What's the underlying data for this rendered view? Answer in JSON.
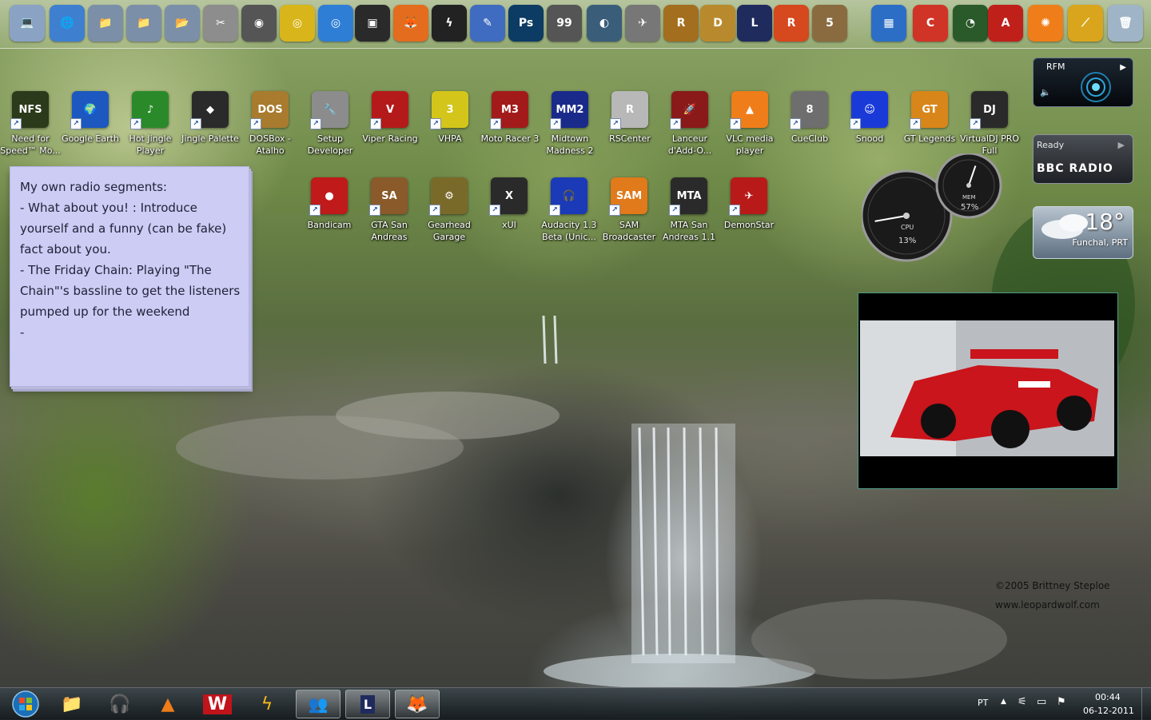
{
  "dock": {
    "items": [
      {
        "name": "computer",
        "glyph": "💻",
        "color": "#8aa3c4"
      },
      {
        "name": "network",
        "glyph": "🌐",
        "color": "#3f7fd0"
      },
      {
        "name": "folder-1",
        "glyph": "📁",
        "color": "#7c8fa8"
      },
      {
        "name": "folder-2",
        "glyph": "📁",
        "color": "#7c8fa8"
      },
      {
        "name": "folder-3",
        "glyph": "📂",
        "color": "#7c8fa8"
      },
      {
        "name": "tools",
        "glyph": "✂",
        "color": "#8d8d8d"
      },
      {
        "name": "speaker",
        "glyph": "◉",
        "color": "#555"
      },
      {
        "name": "cd",
        "glyph": "◎",
        "color": "#d8b51a"
      },
      {
        "name": "dvd",
        "glyph": "◎",
        "color": "#2e7ed6"
      },
      {
        "name": "webcam",
        "glyph": "▣",
        "color": "#2a2a2a"
      },
      {
        "name": "firefox",
        "glyph": "🦊",
        "color": "#e46c1e"
      },
      {
        "name": "winamp",
        "glyph": "ϟ",
        "color": "#222"
      },
      {
        "name": "paint",
        "glyph": "✎",
        "color": "#3f6cc0"
      },
      {
        "name": "photoshop",
        "glyph": "Ps",
        "color": "#0c3b63"
      },
      {
        "name": "monitor-99",
        "glyph": "99",
        "color": "#555"
      },
      {
        "name": "teamspeak",
        "glyph": "◐",
        "color": "#3a5d7a"
      },
      {
        "name": "plane",
        "glyph": "✈",
        "color": "#777"
      },
      {
        "name": "rally",
        "glyph": "R",
        "color": "#a36e1d"
      },
      {
        "name": "dosbox",
        "glyph": "D",
        "color": "#b98a2d"
      },
      {
        "name": "lfs",
        "glyph": "L",
        "color": "#1f2b5d"
      },
      {
        "name": "r",
        "glyph": "R",
        "color": "#d6481d"
      },
      {
        "name": "rfactor",
        "glyph": "5",
        "color": "#8a6b40"
      },
      {
        "name": "windows-monitor",
        "glyph": "▦",
        "color": "#2c6ec5"
      },
      {
        "name": "ccleaner",
        "glyph": "C",
        "color": "#d03426"
      },
      {
        "name": "mouse",
        "glyph": "◔",
        "color": "#2a5a2a"
      },
      {
        "name": "acrobat",
        "glyph": "A",
        "color": "#c0201a"
      },
      {
        "name": "avast",
        "glyph": "✺",
        "color": "#ef7e1a"
      },
      {
        "name": "wand",
        "glyph": "⟋",
        "color": "#d9a51c"
      },
      {
        "name": "recycle-bin",
        "glyph": "🗑",
        "color": "#9fb4c6"
      }
    ]
  },
  "desktop": {
    "row1": [
      {
        "label": "Need for Speed™ Mo...",
        "glyph": "NFS",
        "color": "#2b3a1a"
      },
      {
        "label": "Google Earth",
        "glyph": "🌍",
        "color": "#1c58c0"
      },
      {
        "label": "Hot Jingle Player",
        "glyph": "♪",
        "color": "#2a8a2a"
      },
      {
        "label": "Jingle Palette",
        "glyph": "◆",
        "color": "#2a2a2a"
      },
      {
        "label": "DOSBox - Atalho",
        "glyph": "DOS",
        "color": "#a87b2e"
      },
      {
        "label": "Setup Developer",
        "glyph": "🔧",
        "color": "#8c8c8c"
      },
      {
        "label": "Viper Racing",
        "glyph": "V",
        "color": "#b51a1a"
      },
      {
        "label": "VHPA",
        "glyph": "3",
        "color": "#d4c51a"
      },
      {
        "label": "Moto Racer 3",
        "glyph": "M3",
        "color": "#a31a1a"
      },
      {
        "label": "Midtown Madness 2",
        "glyph": "MM2",
        "color": "#1a2a8a"
      },
      {
        "label": "RSCenter",
        "glyph": "R",
        "color": "#b8b8b8"
      },
      {
        "label": "Lanceur d'Add-O...",
        "glyph": "🚀",
        "color": "#8a1a1a"
      },
      {
        "label": "VLC media player",
        "glyph": "▲",
        "color": "#ef7d1a"
      },
      {
        "label": "CueClub",
        "glyph": "8",
        "color": "#6e6e6e"
      },
      {
        "label": "Snood",
        "glyph": "☺",
        "color": "#1a3ad8"
      },
      {
        "label": "GT Legends",
        "glyph": "GT",
        "color": "#d8861a"
      },
      {
        "label": "VirtualDJ PRO Full",
        "glyph": "DJ",
        "color": "#2a2a2a"
      }
    ],
    "row2": [
      {
        "label": "Bandicam",
        "glyph": "●",
        "color": "#c01a1a"
      },
      {
        "label": "GTA San Andreas",
        "glyph": "SA",
        "color": "#8a5a2a"
      },
      {
        "label": "Gearhead Garage",
        "glyph": "⚙",
        "color": "#7a6a2a"
      },
      {
        "label": "xUI",
        "glyph": "X",
        "color": "#2a2a2a"
      },
      {
        "label": "Audacity 1.3 Beta (Unic...",
        "glyph": "🎧",
        "color": "#1a3ab8"
      },
      {
        "label": "SAM Broadcaster",
        "glyph": "SAM",
        "color": "#e07a1a"
      },
      {
        "label": "MTA San Andreas 1.1",
        "glyph": "MTA",
        "color": "#2a2a2a"
      },
      {
        "label": "DemonStar",
        "glyph": "✈",
        "color": "#b81a1a"
      }
    ]
  },
  "sticky_note": {
    "lines": [
      "My own radio segments:",
      "- What about you! : Introduce",
      "yourself and a funny (can be fake)",
      "fact about you.",
      "- The Friday Chain: Playing \"The",
      "Chain\"'s bassline to get the listeners",
      "pumped up for the weekend",
      "-"
    ]
  },
  "gadgets": {
    "rfm": {
      "title": "RFM"
    },
    "bbc": {
      "status": "Ready",
      "logo": "BBC RADIO"
    },
    "weather": {
      "temp": "18°",
      "location": "Funchal, PRT"
    },
    "meters": {
      "cpu_label": "CPU",
      "cpu": "13%",
      "mem_label": "MEM",
      "mem": "57%",
      "cpu_value": 13,
      "mem_value": 57
    }
  },
  "wallpaper": {
    "credit1": "©2005  Brittney  Steploe",
    "credit2": "www.leopardwolf.com"
  },
  "taskbar": {
    "language": "PT",
    "time": "00:44",
    "date": "06-12-2011"
  },
  "colors": {
    "sticky_bg": "#ccccf4",
    "taskbar": "#1c2327",
    "photo_border": "#4e9a86"
  }
}
